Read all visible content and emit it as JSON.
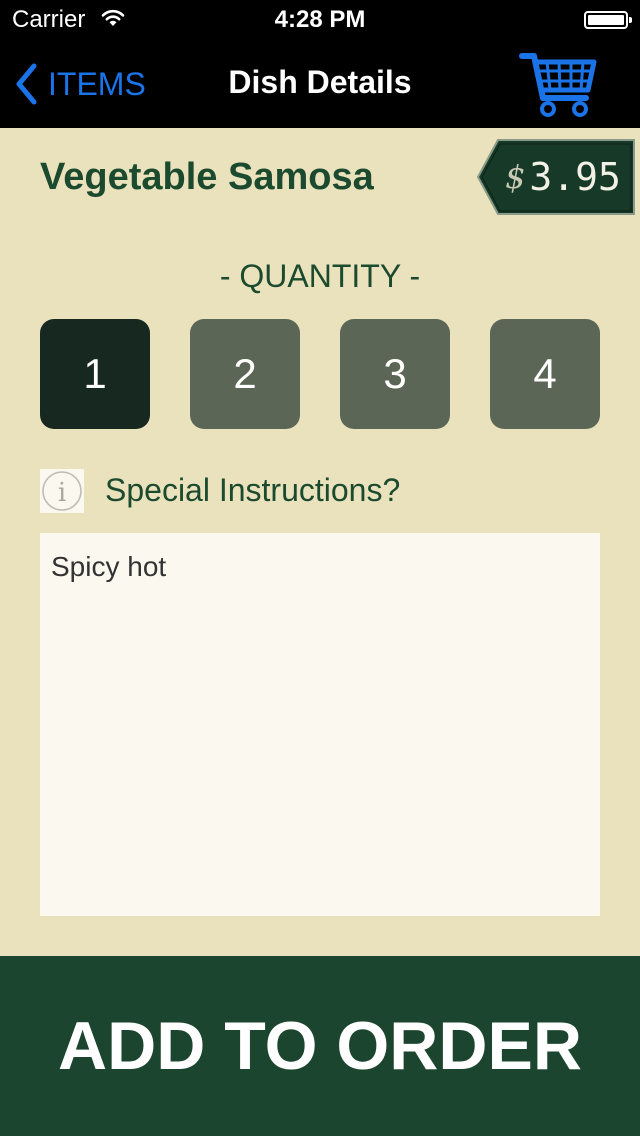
{
  "status_bar": {
    "carrier": "Carrier",
    "time": "4:28 PM"
  },
  "nav": {
    "back_label": "ITEMS",
    "title": "Dish Details",
    "cart_icon": "shopping-cart-icon"
  },
  "dish": {
    "name": "Vegetable Samosa",
    "currency_symbol": "$",
    "price": "3.95"
  },
  "quantity": {
    "label": "- QUANTITY -",
    "options": [
      "1",
      "2",
      "3",
      "4"
    ],
    "selected": "1"
  },
  "special_instructions": {
    "label": "Special Instructions?",
    "value": "Spicy hot"
  },
  "add_button": {
    "label": "ADD TO ORDER"
  },
  "colors": {
    "background": "#e9e2bc",
    "dark_green": "#1b452e",
    "accent_blue": "#1a74e8",
    "qty_selected": "#172820",
    "qty_unselected": "#5b6656"
  }
}
